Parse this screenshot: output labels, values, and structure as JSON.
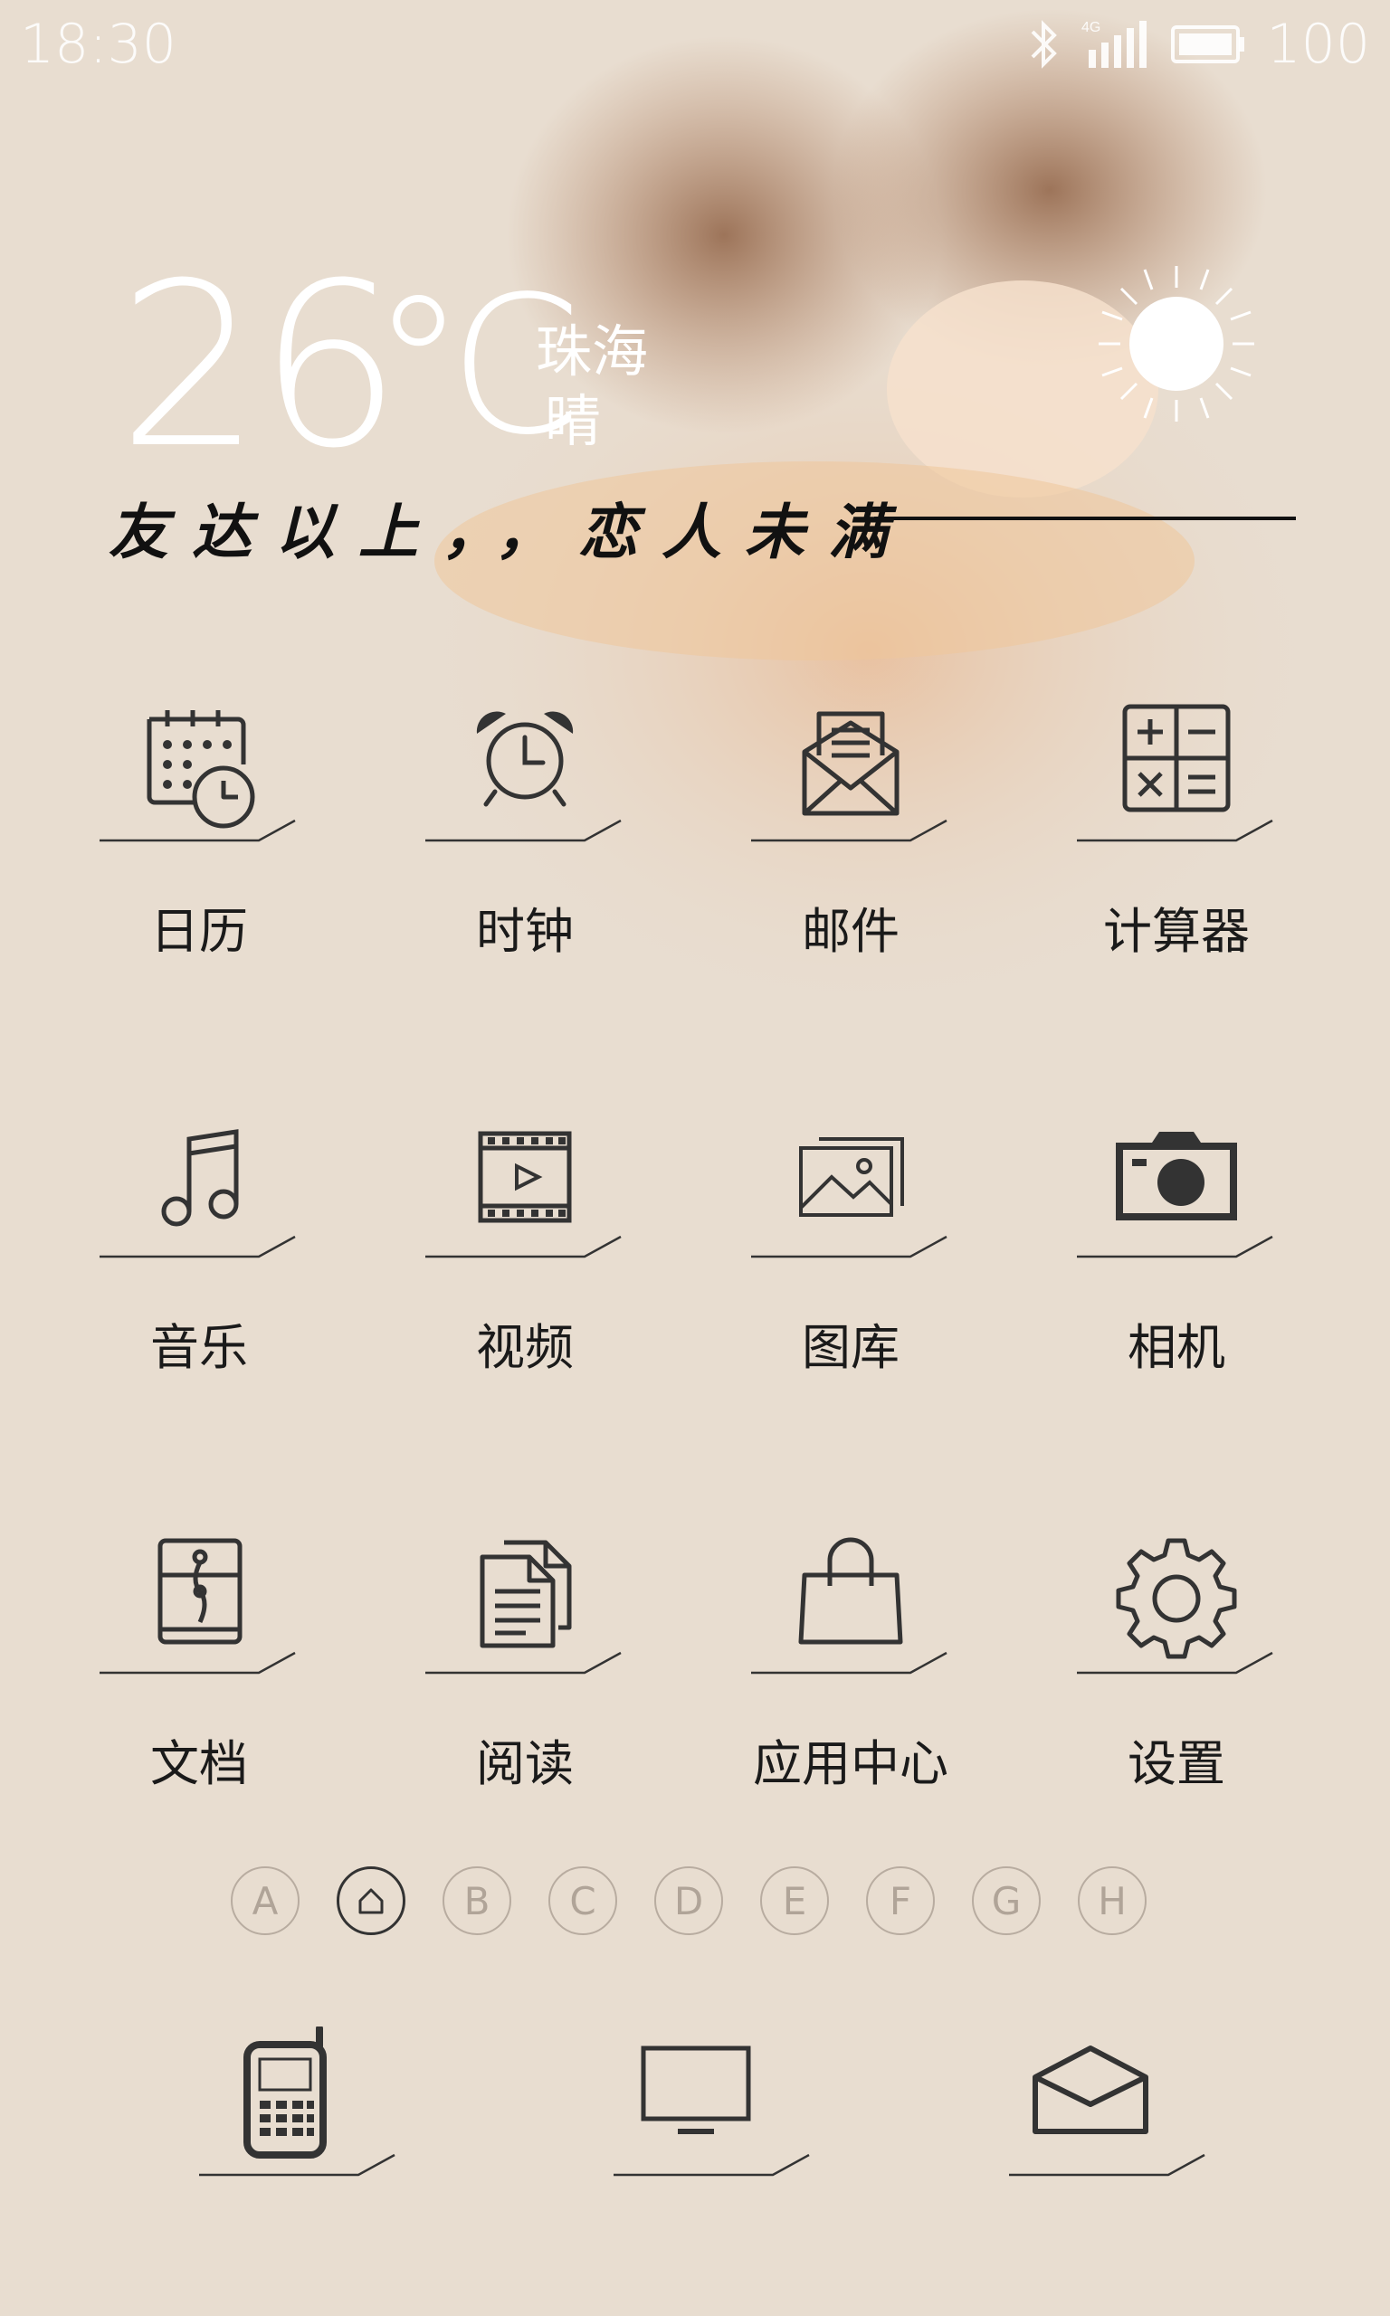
{
  "status_bar": {
    "time": "18:30",
    "network": "4G",
    "battery": "100"
  },
  "weather": {
    "temperature": "26",
    "unit": "℃",
    "city": "珠海",
    "condition": "晴",
    "icon": "sun-icon"
  },
  "slogan": "友达以上，，恋人未满",
  "apps": [
    {
      "label": "日历",
      "icon": "calendar-icon"
    },
    {
      "label": "时钟",
      "icon": "alarm-clock-icon"
    },
    {
      "label": "邮件",
      "icon": "mail-icon"
    },
    {
      "label": "计算器",
      "icon": "calculator-icon"
    },
    {
      "label": "音乐",
      "icon": "music-note-icon"
    },
    {
      "label": "视频",
      "icon": "film-icon"
    },
    {
      "label": "图库",
      "icon": "gallery-icon"
    },
    {
      "label": "相机",
      "icon": "camera-icon"
    },
    {
      "label": "文档",
      "icon": "document-folder-icon"
    },
    {
      "label": "阅读",
      "icon": "reading-icon"
    },
    {
      "label": "应用中心",
      "icon": "shopping-bag-icon"
    },
    {
      "label": "设置",
      "icon": "gear-icon"
    }
  ],
  "pager": [
    "A",
    "home",
    "B",
    "C",
    "D",
    "E",
    "F",
    "G",
    "H"
  ],
  "pager_active": "home",
  "dock": [
    {
      "icon": "phone-icon"
    },
    {
      "icon": "monitor-icon"
    },
    {
      "icon": "envelope-icon"
    }
  ],
  "colors": {
    "background": "#e8ddd0",
    "text": "#1a1a1a",
    "status_text": "#ffffff"
  }
}
